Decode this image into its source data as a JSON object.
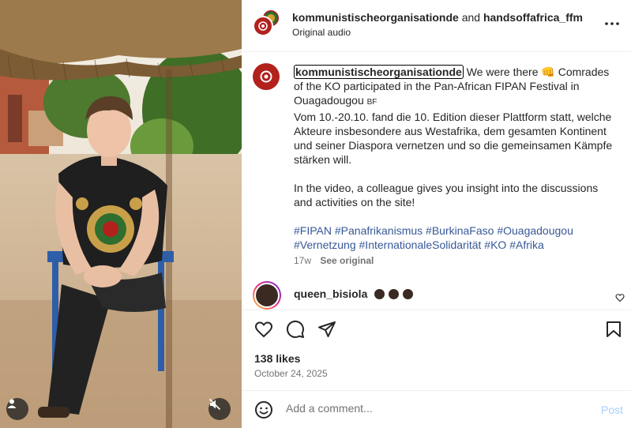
{
  "header": {
    "author1": "kommunistischeorganisationde",
    "joiner": "and",
    "author2": "handsoffafrica_ffm",
    "audio": "Original audio",
    "more_icon": "more-horizontal-icon"
  },
  "caption": {
    "username": "kommunistischeorganisationde",
    "line1_rest": " We were there 👊 Comrades of the KO participated in the Pan-African FIPAN Festival in Ouagadougou ",
    "country_flag": "BF",
    "german": "Vom 10.-20.10. fand die 10. Edition dieser Plattform statt, welche Akteure insbesondere aus Westafrika, dem gesamten Kontinent und seiner Diaspora vernetzen und so die gemeinsamen Kämpfe stärken will.",
    "english": "In the video, a colleague gives you insight into the discussions and activities on the site!",
    "hashtags": [
      "#FIPAN",
      "#Panafrikanismus",
      "#BurkinaFaso",
      "#Ouagadougou",
      "#Vernetzung",
      "#InternationaleSolidarität",
      "#KO",
      "#Afrika"
    ],
    "age": "17w",
    "see_original": "See original"
  },
  "comment": {
    "username": "queen_bisiola"
  },
  "actions": {
    "like_icon": "heart-icon",
    "comment_icon": "comment-icon",
    "share_icon": "share-icon",
    "save_icon": "bookmark-icon"
  },
  "likes": "138 likes",
  "date": "October 24, 2025",
  "add_comment": {
    "placeholder": "Add a comment...",
    "post_label": "Post",
    "emoji_icon": "emoji-icon"
  },
  "media": {
    "user_tag_icon": "user-tag-icon",
    "mute_icon": "speaker-muted-icon"
  },
  "colors": {
    "link": "#385898",
    "brand_red": "#b3211d",
    "post_disabled": "#a6cefc"
  }
}
